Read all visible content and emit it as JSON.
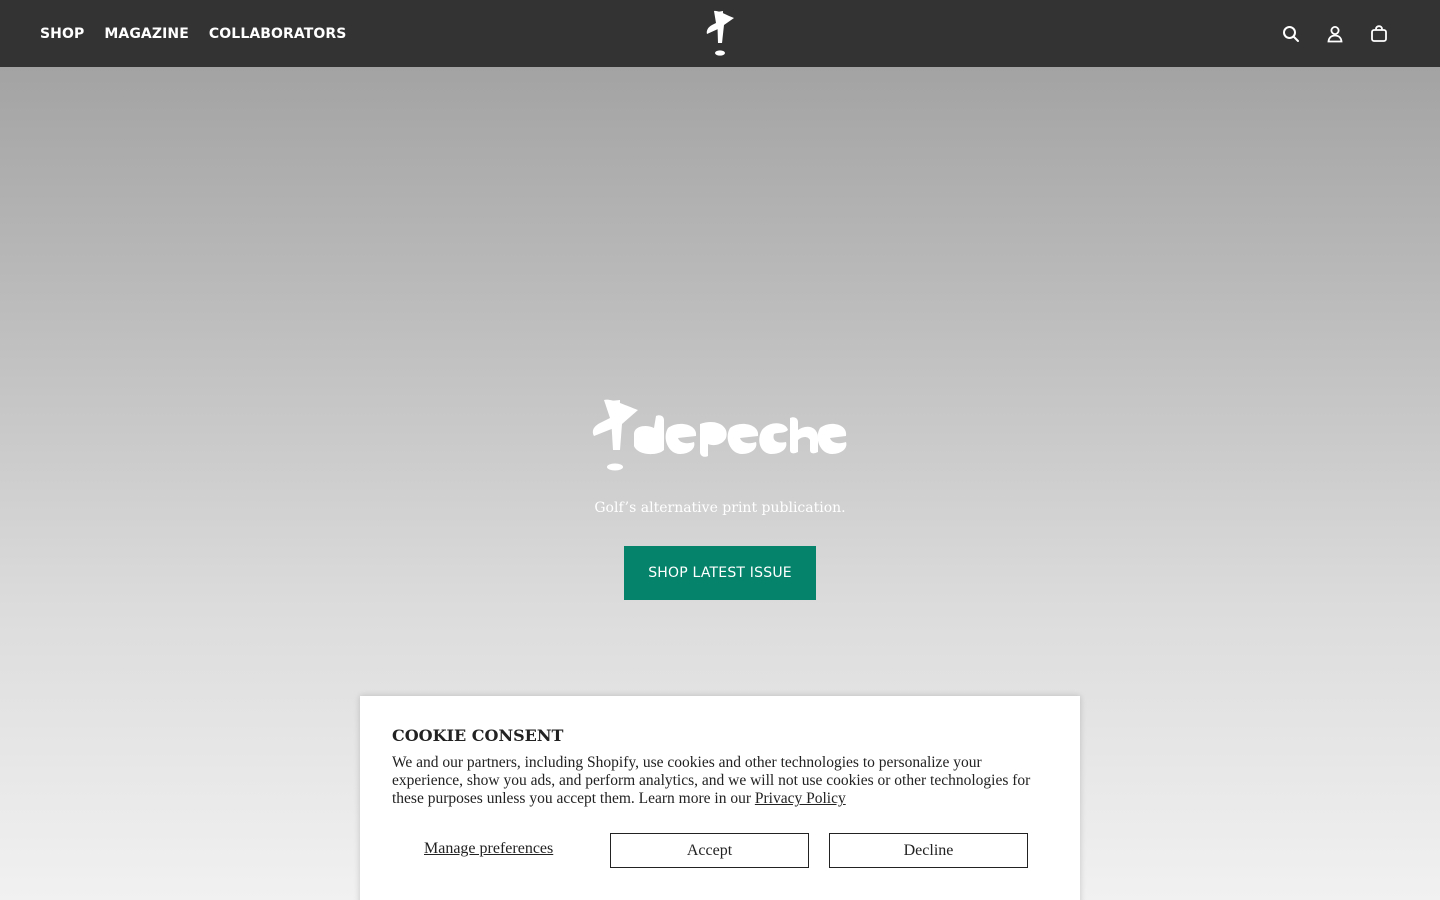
{
  "header": {
    "nav": [
      {
        "label": "SHOP"
      },
      {
        "label": "MAGAZINE"
      },
      {
        "label": "COLLABORATORS"
      }
    ],
    "logo_icon": "golf-flag-logo",
    "icons": [
      "search-icon",
      "account-icon",
      "cart-icon"
    ]
  },
  "hero": {
    "logo_text": "depeche",
    "tagline": "Golf’s alternative print publication.",
    "cta_label": "SHOP LATEST ISSUE",
    "cta_color": "#05846b"
  },
  "cookie": {
    "title": "COOKIE CONSENT",
    "body": "We and our partners, including Shopify, use cookies and other technologies to personalize your experience, show you ads, and perform analytics, and we will not use cookies or other technologies for these purposes unless you accept them. Learn more in our ",
    "privacy_link": "Privacy Policy",
    "manage_label": "Manage preferences",
    "accept_label": "Accept",
    "decline_label": "Decline"
  },
  "colors": {
    "header_bg": "#333333",
    "hero_gradient_top": "#a3a3a3",
    "hero_gradient_bottom": "#f1f1f1"
  }
}
